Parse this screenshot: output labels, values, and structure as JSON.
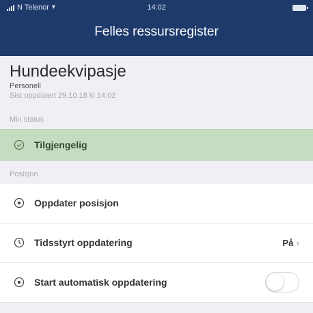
{
  "status_bar": {
    "carrier": "N Telenor",
    "time": "14:02"
  },
  "nav": {
    "title": "Felles ressursregister"
  },
  "resource": {
    "name": "Hundeekvipasje",
    "type": "Personell",
    "updated": "Sist oppdatert 29.10.18 kl 14:02"
  },
  "status_section": {
    "label": "Min status",
    "current": "Tilgjengelig"
  },
  "position_section": {
    "label": "Posisjon",
    "rows": [
      {
        "label": "Oppdater posisjon",
        "icon": "location-icon"
      },
      {
        "label": "Tidsstyrt oppdatering",
        "icon": "clock-icon",
        "value": "På"
      },
      {
        "label": "Start automatisk oppdatering",
        "icon": "location-icon",
        "toggle_on": false
      }
    ]
  },
  "colors": {
    "header": "#1d3a6b",
    "status_available": "#c5dcc0",
    "background": "#efeff4"
  }
}
